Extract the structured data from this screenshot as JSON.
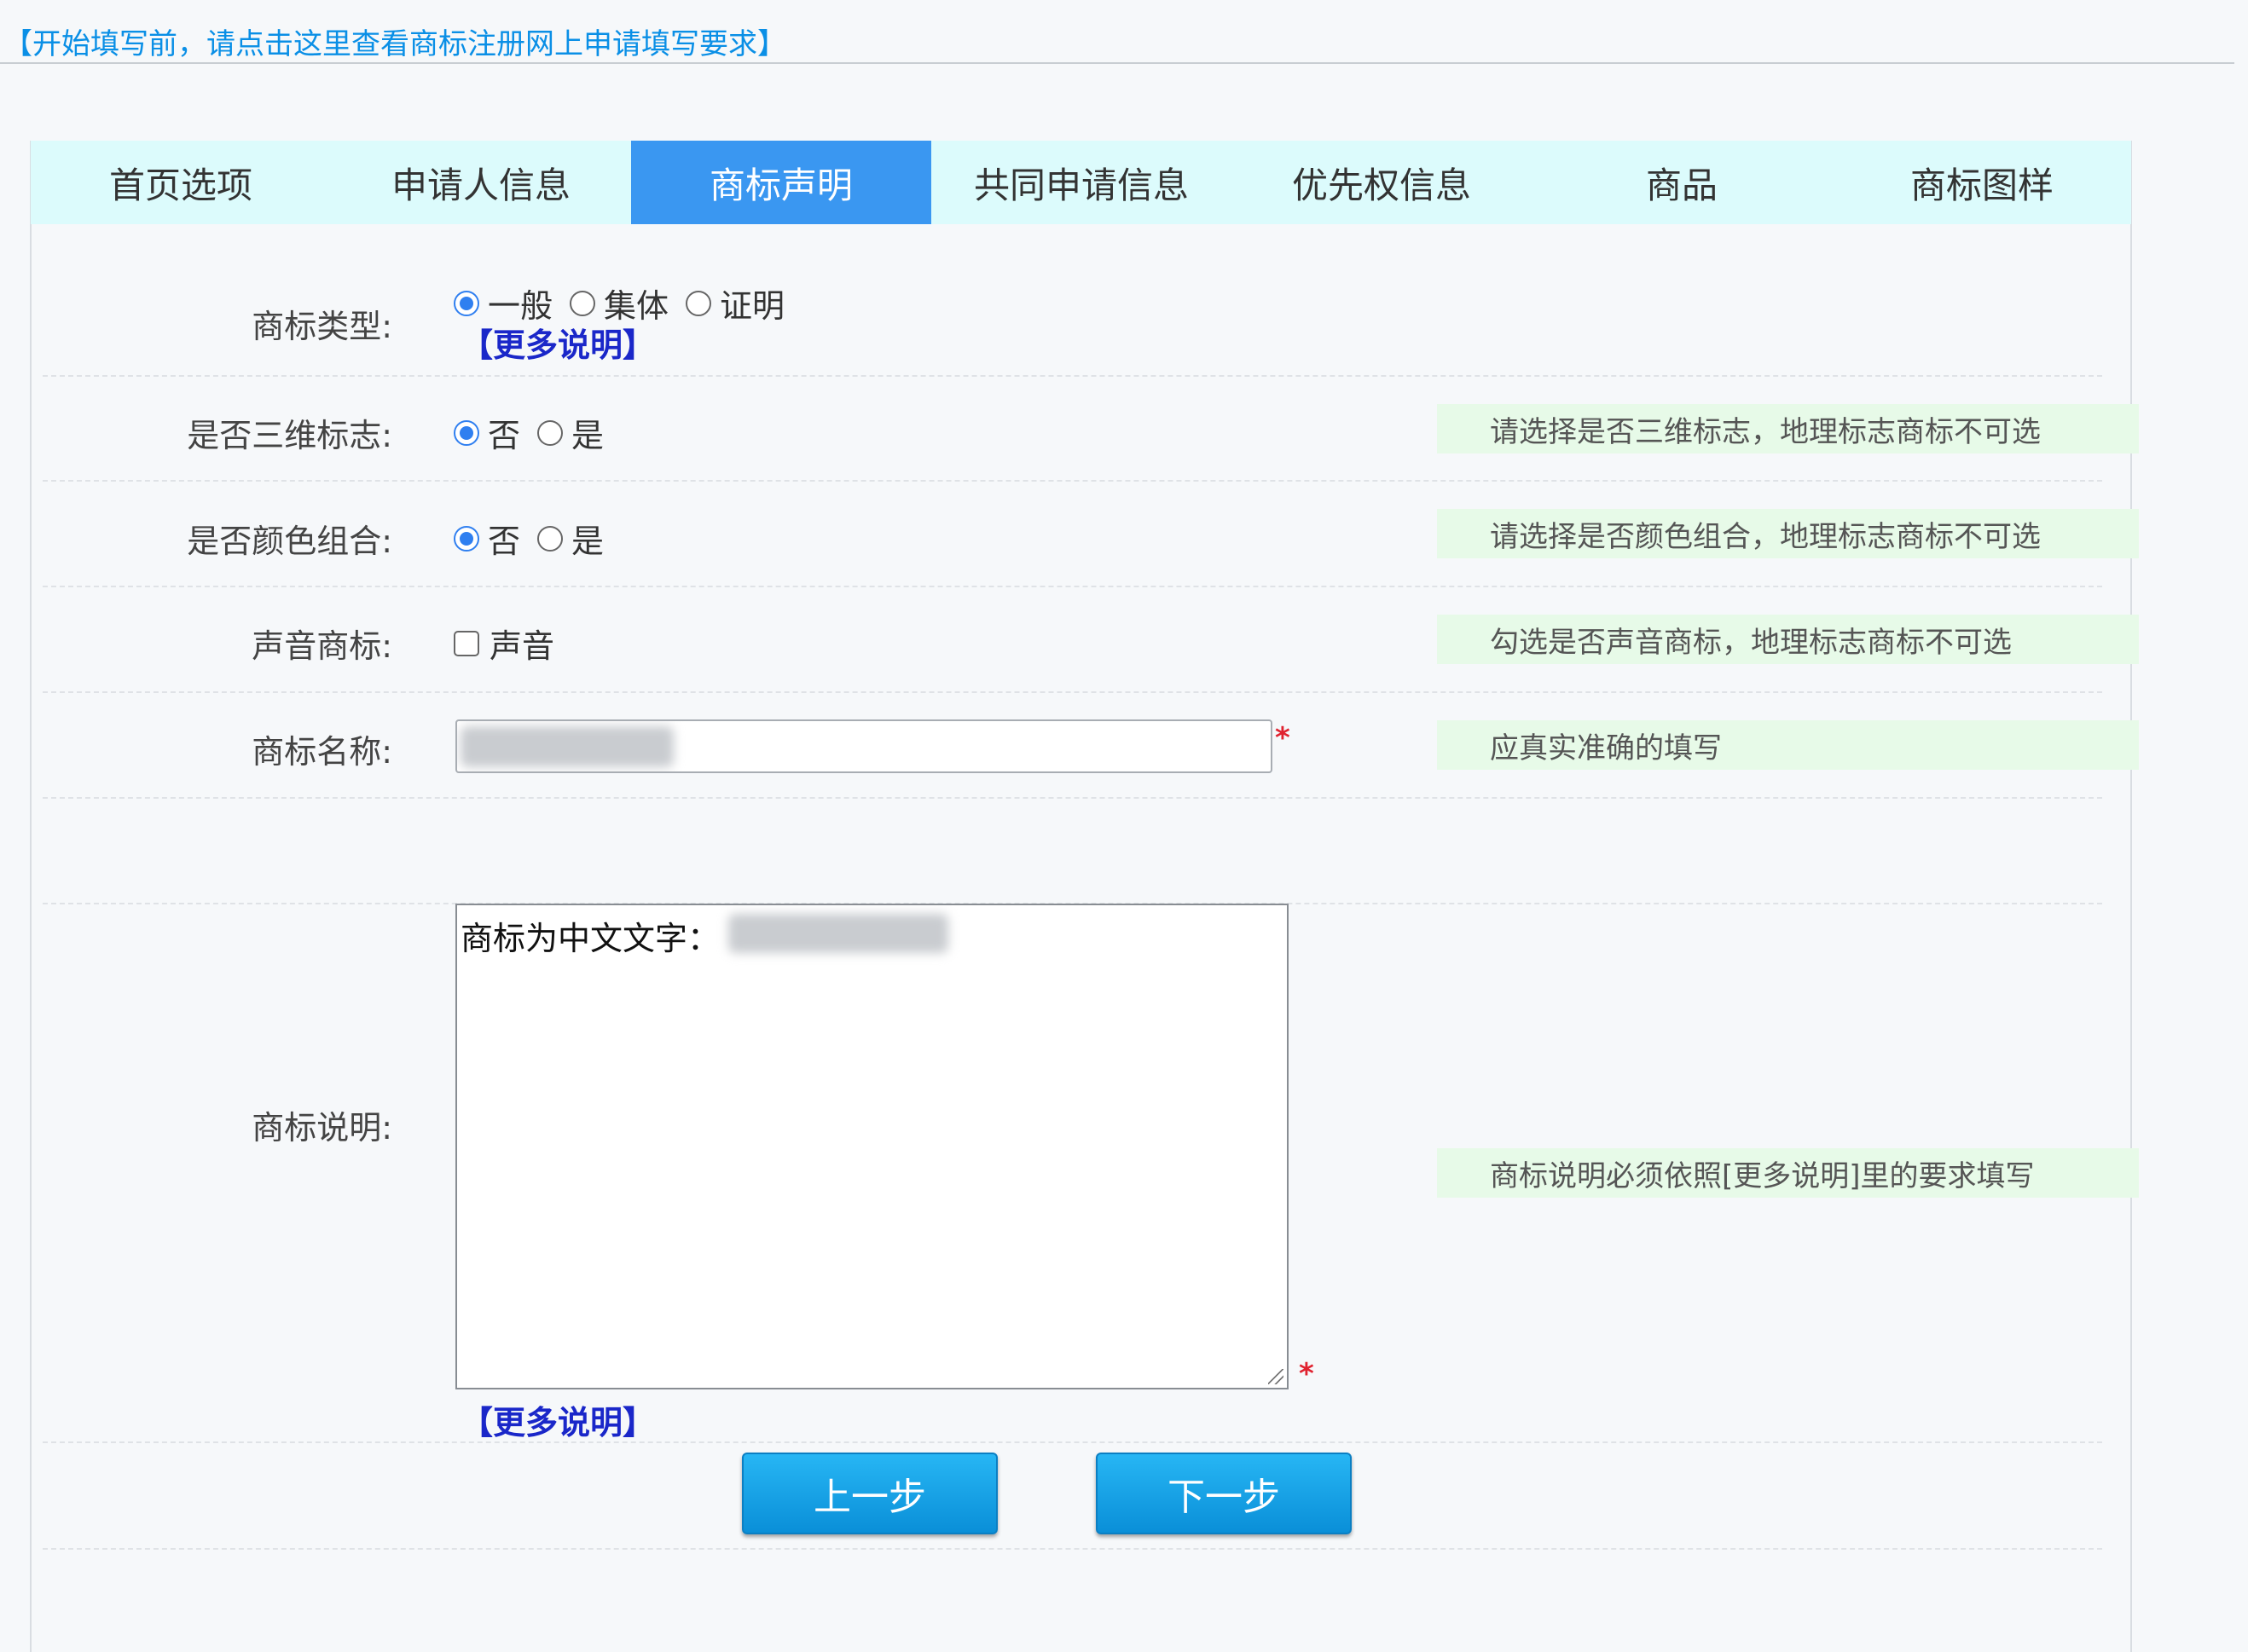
{
  "top_link": "【开始填写前，请点击这里查看商标注册网上申请填写要求】",
  "tabs": [
    {
      "label": "首页选项",
      "active": false
    },
    {
      "label": "申请人信息",
      "active": false
    },
    {
      "label": "商标声明",
      "active": true
    },
    {
      "label": "共同申请信息",
      "active": false
    },
    {
      "label": "优先权信息",
      "active": false
    },
    {
      "label": "商品",
      "active": false
    },
    {
      "label": "商标图样",
      "active": false
    }
  ],
  "trademark_type": {
    "label": "商标类型:",
    "options": [
      "一般",
      "集体",
      "证明"
    ],
    "selected": "一般",
    "more_link": "【更多说明】"
  },
  "three_d": {
    "label": "是否三维标志:",
    "options": [
      "否",
      "是"
    ],
    "selected": "否",
    "hint": "请选择是否三维标志，地理标志商标不可选"
  },
  "color_combo": {
    "label": "是否颜色组合:",
    "options": [
      "否",
      "是"
    ],
    "selected": "否",
    "hint": "请选择是否颜色组合，地理标志商标不可选"
  },
  "sound": {
    "label": "声音商标:",
    "checkbox_label": "声音",
    "checked": false,
    "hint": "勾选是否声音商标，地理标志商标不可选"
  },
  "trademark_name": {
    "label": "商标名称:",
    "required_mark": "*",
    "hint": "应真实准确的填写"
  },
  "trademark_desc": {
    "label": "商标说明:",
    "value_prefix": "商标为中文文字：",
    "required_mark": "*",
    "hint": "商标说明必须依照[更多说明]里的要求填写",
    "more_link": "【更多说明】"
  },
  "buttons": {
    "prev": "上一步",
    "next": "下一步"
  },
  "colors": {
    "link": "#0a8fe6",
    "active_tab": "#3a97f1",
    "tab_bar": "#dcfbfc",
    "hint_bg": "#e7fae8",
    "more_link": "#1a27c9",
    "button": "#129fe6",
    "required": "#e0222f"
  }
}
